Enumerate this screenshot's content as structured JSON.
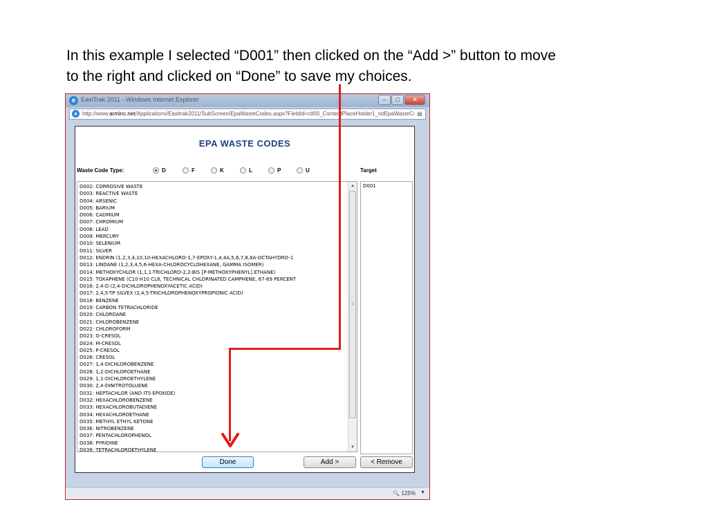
{
  "caption": {
    "line1": "In this example I selected “D001” then clicked on the “Add >” button to move",
    "line2": "to the right and clicked on “Done” to save my choices."
  },
  "browser": {
    "title": "EasiTrak 2011 - Windows Internet Explorer",
    "address_host": "http://www.",
    "address_domain": "arminc.net",
    "address_path": "/Applications/Easitrak2011/SubScreen/EpaWasteCodes.aspx?FieldId=ctl00_ContentPlaceHolder1_txtEpaWasteCod",
    "zoom": "125%"
  },
  "page": {
    "title": "EPA WASTE CODES",
    "waste_code_type_label": "Waste Code Type:",
    "target_label": "Target",
    "radio_options": [
      {
        "label": "D",
        "selected": true
      },
      {
        "label": "F",
        "selected": false
      },
      {
        "label": "K",
        "selected": false
      },
      {
        "label": "L",
        "selected": false
      },
      {
        "label": "P",
        "selected": false
      },
      {
        "label": "U",
        "selected": false
      }
    ],
    "source_list": [
      "D002: CORROSIVE WASTE",
      "D003: REACTIVE WASTE",
      "D004: ARSENIC",
      "D005: BARIUM",
      "D006: CADMIUM",
      "D007: CHROMIUM",
      "D008: LEAD",
      "D009: MERCURY",
      "D010: SELENIUM",
      "D011: SILVER",
      "D012: ENDRIN (1,2,3,4,10,10-HEXACHLORO-1,7-EPOXY-1,4,4A,5,6,7,8,8A-OCTAHYDRO-1",
      "D013: LINDANE (1,2,3,4,5,6-HEXA-CHLOROCYCLOHEXANE, GAMMA ISOMER)",
      "D014: METHOXYCHLOR (1,1,1-TRICHLORO-2,2-BIS [P-METHOXYPHENYL] ETHANE)",
      "D015: TOXAPHENE (C10 H10 CL8, TECHNICAL CHLORINATED CAMPHENE, 67-69 PERCENT",
      "D016: 2,4-D (2,4-DICHLOROPHENOXYACETIC ACID)",
      "D017: 2,4,5-TP SILVEX (2,4,5-TRICHLOROPHENOXYPROPIONIC ACID)",
      "D018: BENZENE",
      "D019: CARBON TETRACHLORIDE",
      "D020: CHLORDANE",
      "D021: CHLOROBENZENE",
      "D022: CHLOROFORM",
      "D023: O-CRESOL",
      "D024: M-CRESOL",
      "D025: P-CRESOL",
      "D026: CRESOL",
      "D027: 1,4-DICHLOROBENZENE",
      "D028: 1,2-DICHLOROETHANE",
      "D029: 1,1-DICHLOROETHYLENE",
      "D030: 2,4-DINITROTOLUENE",
      "D031: HEPTACHLOR (AND ITS EPOXIDE)",
      "D032: HEXACHLOROBENZENE",
      "D033: HEXACHLOROBUTADIENE",
      "D034: HEXACHLOROETHANE",
      "D035: METHYL ETHYL KETONE",
      "D036: NITROBENZENE",
      "D037: PENTACHLOROPHENOL",
      "D038: PYRIDINE",
      "D039: TETRACHLOROETHYLENE"
    ],
    "target_list": [
      "D001"
    ],
    "done_label": "Done",
    "add_label": "Add >",
    "remove_label": "< Remove"
  },
  "colors": {
    "annotation_arrow": "#e01b1b",
    "title_blue": "#1e3f7f"
  }
}
